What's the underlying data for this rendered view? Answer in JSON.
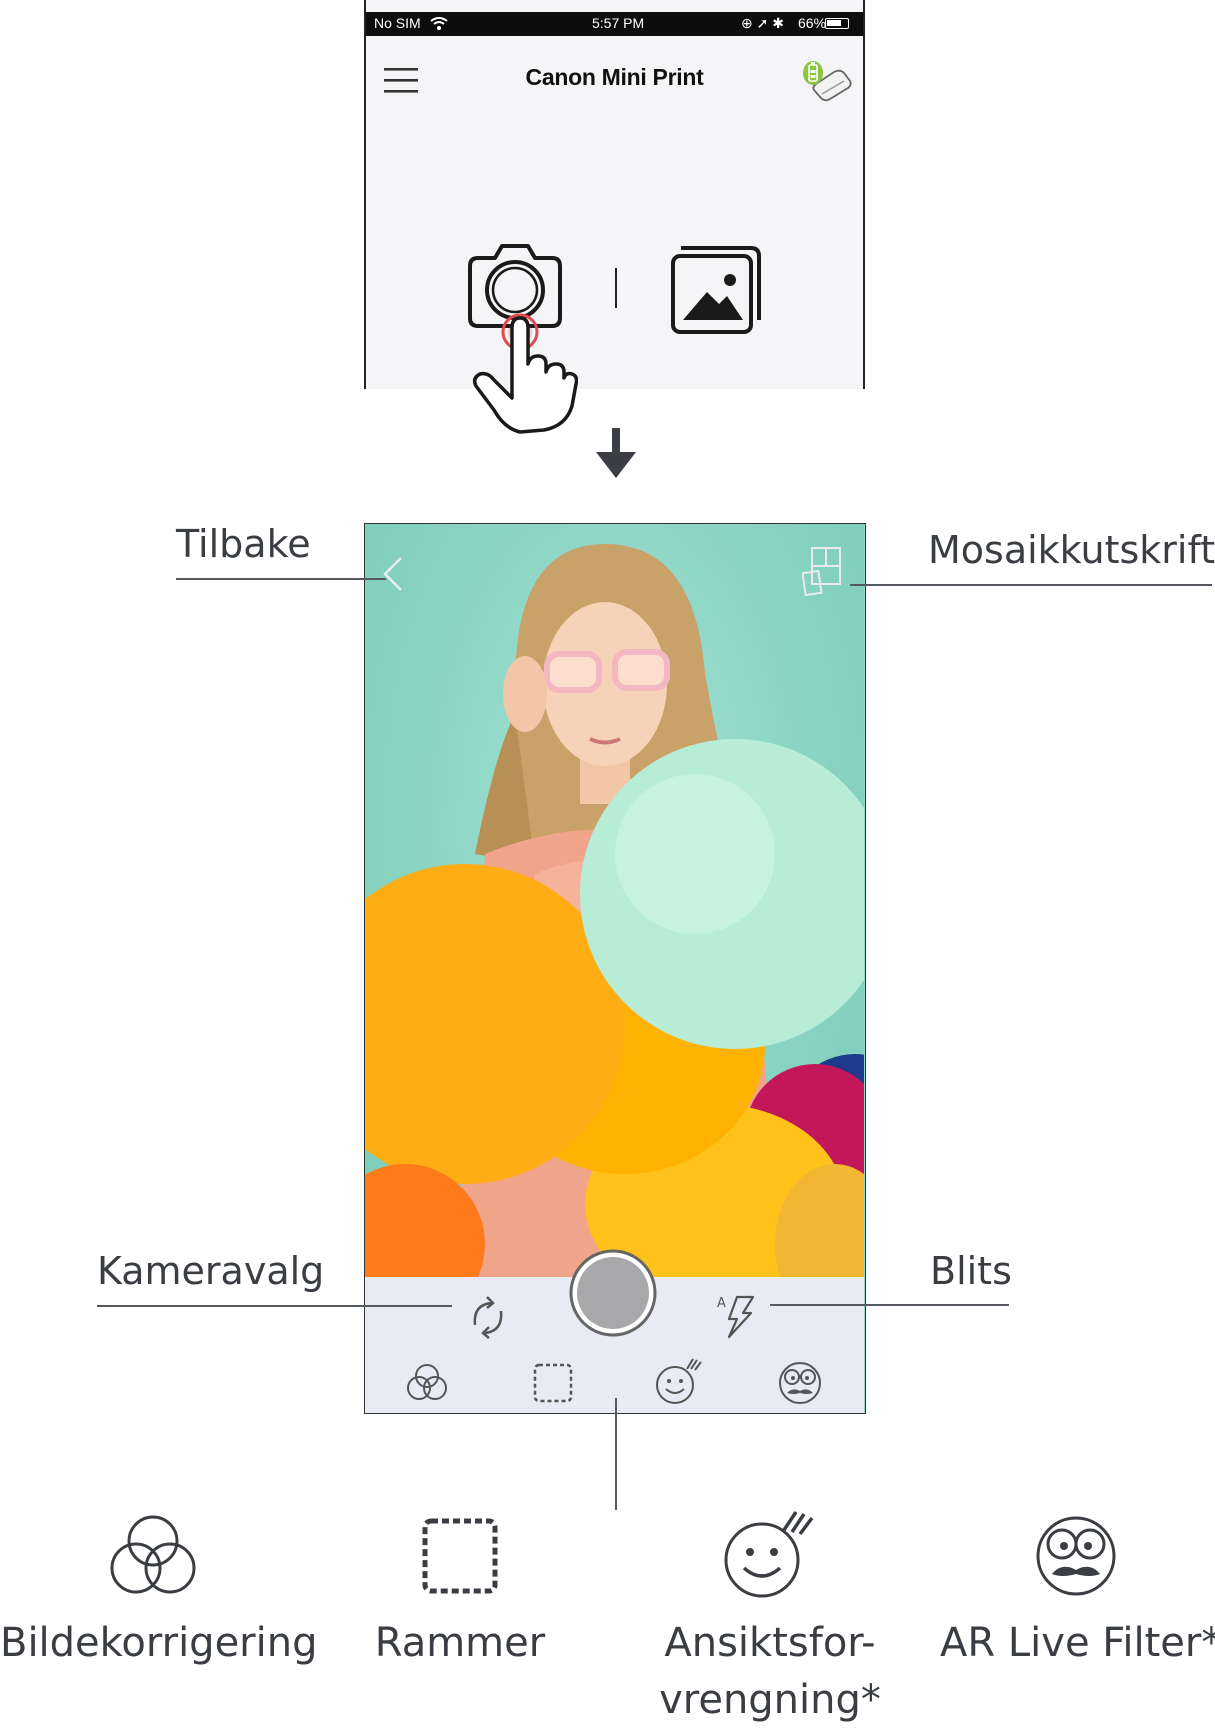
{
  "status_bar": {
    "carrier": "No SIM",
    "time": "5:57 PM",
    "battery": "66%"
  },
  "app": {
    "title": "Canon Mini Print"
  },
  "home_icons": [
    "menu-icon",
    "printer-status-icon",
    "camera-icon",
    "gallery-icon",
    "tap-hand-icon"
  ],
  "camera_toolbar": {
    "icons": [
      "flip-camera-icon",
      "shutter-button",
      "flash-auto-icon",
      "image-adjust-icon",
      "frames-icon",
      "face-distortion-icon",
      "ar-filter-icon"
    ]
  },
  "callouts": {
    "back": "Tilbake",
    "mosaic": "Mosaikkutskrift",
    "camera_select": "Kameravalg",
    "flash": "Blits"
  },
  "features": [
    {
      "label": "Bildekorrigering",
      "icon": "image-adjust-icon"
    },
    {
      "label": "Rammer",
      "icon": "frames-icon"
    },
    {
      "label_line1": "Ansiktsfor-",
      "label_line2": "vrengning*",
      "icon": "face-distortion-icon"
    },
    {
      "label": "AR Live Filter*",
      "icon": "ar-filter-icon"
    }
  ],
  "colors": {
    "accent_green": "#8cc63f",
    "callout_line": "#555a60",
    "preview_teal": "#8fd9c8",
    "toolbar_bg": "#e8eaf4"
  }
}
